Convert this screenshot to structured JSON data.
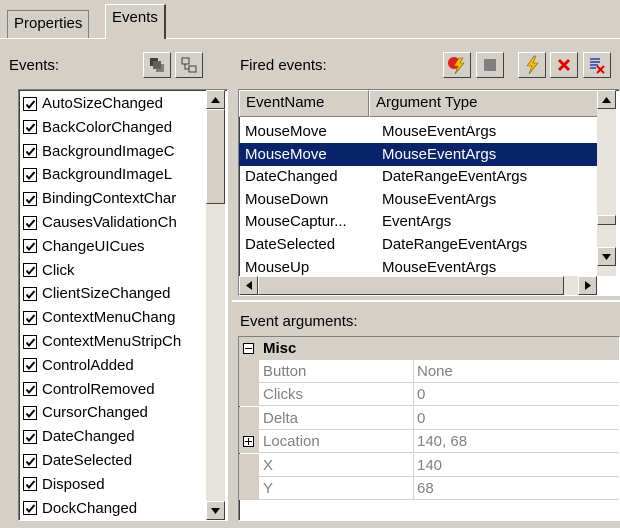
{
  "tabs": [
    {
      "label": "Properties",
      "active": false
    },
    {
      "label": "Events",
      "active": true
    }
  ],
  "left_panel": {
    "label": "Events:",
    "items": [
      "AutoSizeChanged",
      "BackColorChanged",
      "BackgroundImageC",
      "BackgroundImageL",
      "BindingContextChar",
      "CausesValidationCh",
      "ChangeUICues",
      "Click",
      "ClientSizeChanged",
      "ContextMenuChang",
      "ContextMenuStripCh",
      "ControlAdded",
      "ControlRemoved",
      "CursorChanged",
      "DateChanged",
      "DateSelected",
      "Disposed",
      "DockChanged"
    ]
  },
  "fired_panel": {
    "label": "Fired events:",
    "columns": [
      "EventName",
      "Argument Type"
    ],
    "rows": [
      {
        "name": "MouseMove",
        "type": "MouseEventArgs",
        "selected": false
      },
      {
        "name": "MouseMove",
        "type": "MouseEventArgs",
        "selected": true
      },
      {
        "name": "DateChanged",
        "type": "DateRangeEventArgs",
        "selected": false
      },
      {
        "name": "MouseDown",
        "type": "MouseEventArgs",
        "selected": false
      },
      {
        "name": "MouseCaptur...",
        "type": "EventArgs",
        "selected": false
      },
      {
        "name": "DateSelected",
        "type": "DateRangeEventArgs",
        "selected": false
      },
      {
        "name": "MouseUp",
        "type": "MouseEventArgs",
        "selected": false
      }
    ]
  },
  "args_panel": {
    "label": "Event arguments:",
    "category": "Misc",
    "properties": [
      {
        "name": "Button",
        "value": "None"
      },
      {
        "name": "Clicks",
        "value": "0"
      },
      {
        "name": "Delta",
        "value": "0"
      },
      {
        "name": "Location",
        "value": "140, 68"
      },
      {
        "name": "X",
        "value": "140"
      },
      {
        "name": "Y",
        "value": "68"
      }
    ]
  },
  "colors": {
    "selection": "#0a246a",
    "face": "#d4d0c8"
  }
}
